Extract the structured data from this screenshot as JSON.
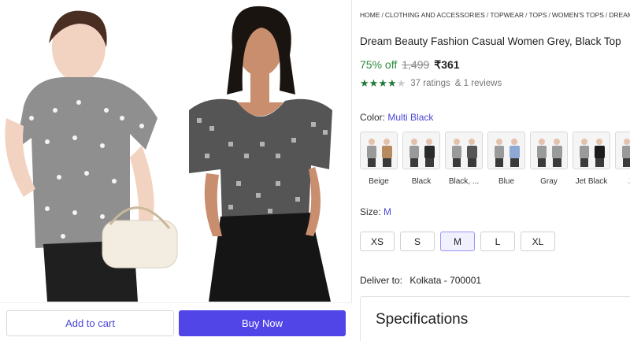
{
  "breadcrumb": [
    "HOME",
    "CLOTHING AND ACCESSORIES",
    "TOPWEAR",
    "TOPS",
    "WOMEN'S TOPS",
    "DREAM BEAU"
  ],
  "product": {
    "title": "Dream Beauty Fashion Casual Women Grey, Black Top",
    "discount": "75% off",
    "mrp": "1,499",
    "price": "₹361",
    "rating_value": 4,
    "rating_max": 5,
    "ratings_text": "37 ratings",
    "reviews_text": "& 1 reviews"
  },
  "color": {
    "label": "Color:",
    "selected": "Multi Black",
    "options": [
      "Beige",
      "Black",
      "Black, ...",
      "Blue",
      "Gray",
      "Jet Black",
      "Joy"
    ]
  },
  "size": {
    "label": "Size:",
    "selected": "M",
    "options": [
      "XS",
      "S",
      "M",
      "L",
      "XL"
    ]
  },
  "delivery": {
    "label": "Deliver to:",
    "location": "Kolkata - 700001"
  },
  "specifications": {
    "title": "Specifications"
  },
  "actions": {
    "add_to_cart": "Add to cart",
    "buy_now": "Buy Now"
  },
  "colors": {
    "accent": "#5145e8",
    "discount": "#2e8b3e",
    "star": "#1f7a36"
  }
}
